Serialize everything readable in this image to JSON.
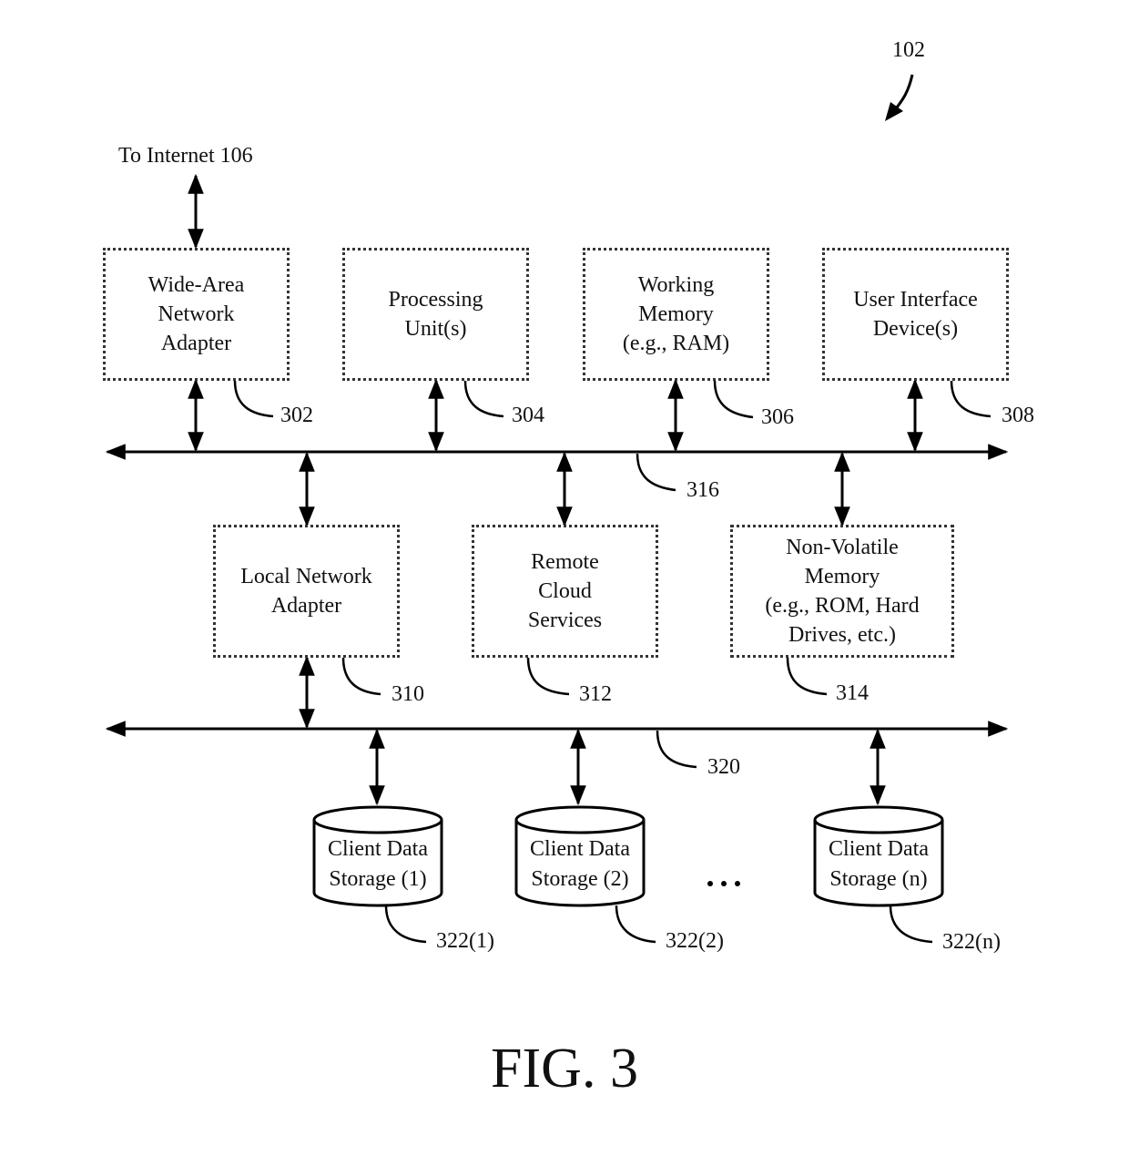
{
  "diagram": {
    "figure_ref": "102",
    "figure_caption": "FIG. 3",
    "internet_label": "To Internet 106",
    "ellipsis": "...",
    "top_row": [
      {
        "id": "302",
        "lines": [
          "Wide-Area",
          "Network",
          "Adapter"
        ]
      },
      {
        "id": "304",
        "lines": [
          "Processing",
          "Unit(s)"
        ]
      },
      {
        "id": "306",
        "lines": [
          "Working",
          "Memory",
          "(e.g., RAM)"
        ]
      },
      {
        "id": "308",
        "lines": [
          "User Interface",
          "Device(s)"
        ]
      }
    ],
    "bus_1": {
      "id": "316"
    },
    "middle_row": [
      {
        "id": "310",
        "lines": [
          "Local Network",
          "Adapter"
        ]
      },
      {
        "id": "312",
        "lines": [
          "Remote",
          "Cloud",
          "Services"
        ]
      },
      {
        "id": "314",
        "lines": [
          "Non-Volatile",
          "Memory",
          "(e.g., ROM, Hard",
          "Drives, etc.)"
        ]
      }
    ],
    "bus_2": {
      "id": "320"
    },
    "storage": [
      {
        "id": "322(1)",
        "lines": [
          "Client Data",
          "Storage (1)"
        ]
      },
      {
        "id": "322(2)",
        "lines": [
          "Client Data",
          "Storage (2)"
        ]
      },
      {
        "id": "322(n)",
        "lines": [
          "Client Data",
          "Storage (n)"
        ]
      }
    ]
  }
}
